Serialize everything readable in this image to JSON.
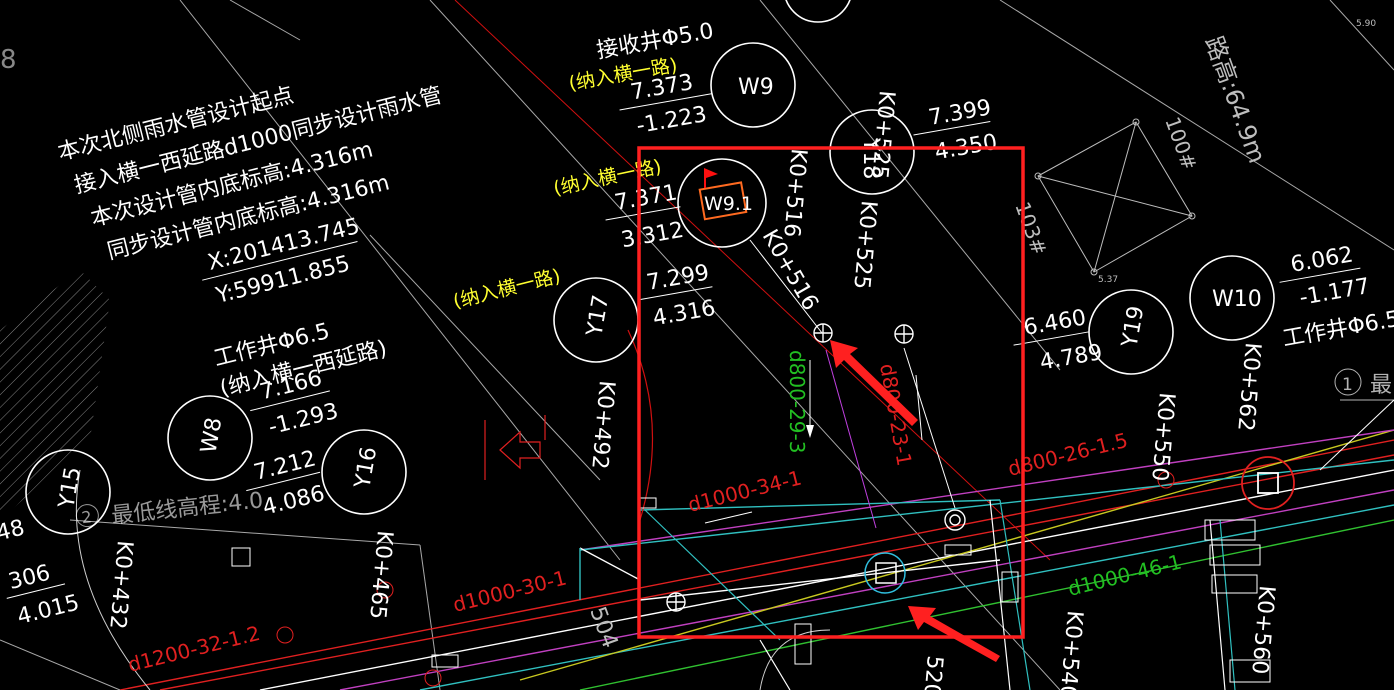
{
  "notes": {
    "line1": "本次北侧雨水管设计起点",
    "line2": "接入横一西延路d1000同步设计雨水管",
    "line3": "本次设计管内底标高:4.316m",
    "line4": "同步设计管内底标高:4.316m"
  },
  "coords": {
    "x": "X:201413.745",
    "y": "Y:59911.855"
  },
  "wells": {
    "W9": {
      "label": "W9",
      "chainage": "K0+525"
    },
    "W9_1": {
      "label": "W9.1",
      "chainage": "K0+516"
    },
    "Y18": {
      "label": "Y18",
      "top": "7.399",
      "bottom": "4.350",
      "chainage": "K0+525"
    },
    "Y17": {
      "label": "Y17",
      "top": "7.299",
      "bottom": "4.316",
      "chainage": "K0+492"
    },
    "Y19": {
      "label": "Y19",
      "top": "6.460",
      "bottom": "4.789",
      "chainage": "K0+550"
    },
    "W10": {
      "label": "W10",
      "top": "6.062",
      "bottom": "-1.177",
      "chainage": "K0+562",
      "note": "工作井Φ6.5"
    },
    "W8": {
      "label": "W8",
      "note1": "工作井Φ6.5",
      "note2": "(纳入横一西延路)",
      "top": "7.166",
      "bottom": "-1.293"
    },
    "Y16": {
      "label": "Y16",
      "top": "7.212",
      "bottom": "4.086",
      "chainage": "K0+465"
    },
    "Y15": {
      "label": "Y15",
      "chainage": "K0+432",
      "v1": "48",
      "v2": "306",
      "v3": "4.015",
      "v4": "4"
    }
  },
  "w9_labels": {
    "receive": "接收井Φ5.0",
    "incorp": "(纳入横一路)",
    "top": "7.373",
    "bottom": "-1.223"
  },
  "w91_labels": {
    "incorp": "(纳入横一路)",
    "top": "7.371",
    "bottom": "3.312"
  },
  "y17_incorp": "(纳入横一路)",
  "pipes": {
    "p1": "d800-29-3",
    "p2": "d800-23-1",
    "p3": "d1000-34-1",
    "p4": "d800-26-1.5",
    "p5": "d1000-46-1",
    "p6": "d1000-30-1",
    "p7": "d1200-32-1.2"
  },
  "misc": {
    "lowest": "最低线高程:4.0",
    "circle2": "2",
    "circle1": "1",
    "zui": "最",
    "level": "路高:64.9m",
    "num100": "100#",
    "num103": "103#",
    "small537": "5.37",
    "small590": "5.90",
    "k540": "K0+540",
    "k520": "520",
    "k560": "K0+560",
    "k504": "504",
    "left8": "8"
  },
  "colors": {
    "highlight": "#ff2020",
    "pipe_green": "#22c022",
    "pipe_red": "#e01818",
    "label_yellow": "#ffff30"
  }
}
